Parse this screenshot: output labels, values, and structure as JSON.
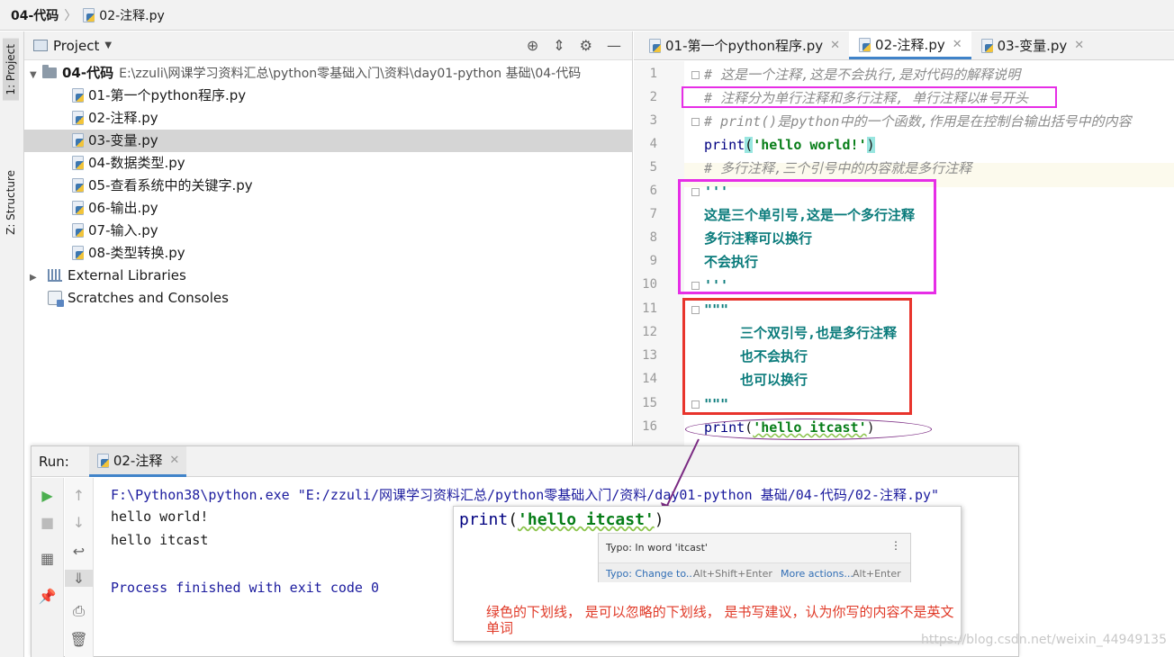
{
  "breadcrumb": {
    "folder": "04-代码",
    "file": "02-注释.py"
  },
  "stripe": {
    "project_tab": "1: Project",
    "structure_tab": "Z: Structure"
  },
  "project": {
    "title": "Project",
    "root": {
      "name": "04-代码",
      "path": "E:\\zzuli\\网课学习资料汇总\\python零基础入门\\资料\\day01-python 基础\\04-代码"
    },
    "files": [
      "01-第一个python程序.py",
      "02-注释.py",
      "03-变量.py",
      "04-数据类型.py",
      "05-查看系统中的关键字.py",
      "06-输出.py",
      "07-输入.py",
      "08-类型转换.py"
    ],
    "selected_index": 2,
    "external_libraries": "External Libraries",
    "scratches": "Scratches and Consoles"
  },
  "editor": {
    "tabs": [
      "01-第一个python程序.py",
      "02-注释.py",
      "03-变量.py"
    ],
    "active_tab": 1,
    "line_numbers": [
      "1",
      "2",
      "3",
      "4",
      "5",
      "6",
      "7",
      "8",
      "9",
      "10",
      "11",
      "12",
      "13",
      "14",
      "15",
      "16"
    ],
    "lines": {
      "l1": "# 这是一个注释,这是不会执行,是对代码的解释说明",
      "l2": "# 注释分为单行注释和多行注释, 单行注释以#号开头",
      "l3": "# print()是python中的一个函数,作用是在控制台输出括号中的内容",
      "l4_fn": "print",
      "l4_open": "(",
      "l4_str": "'hello world!'",
      "l4_close": ")",
      "l5": "# 多行注释,三个引号中的内容就是多行注释",
      "l6": "'''",
      "l7": "这是三个单引号,这是一个多行注释",
      "l8": "多行注释可以换行",
      "l9": "不会执行",
      "l10": "'''",
      "l11": "\"\"\"",
      "l12": "三个双引号,也是多行注释",
      "l13": "也不会执行",
      "l14": "也可以换行",
      "l15": "\"\"\"",
      "l16_fn": "print",
      "l16_open": "(",
      "l16_str": "'hello itcast'",
      "l16_close": ")"
    }
  },
  "run": {
    "label": "Run:",
    "tab": "02-注释",
    "console": [
      "F:\\Python38\\python.exe \"E:/zzuli/网课学习资料汇总/python零基础入门/资料/day01-python 基础/04-代码/02-注释.py\"",
      "hello world!",
      "hello itcast",
      "Process finished with exit code 0"
    ]
  },
  "callout": {
    "code_fn": "print",
    "code_open": "(",
    "code_str": "'hello itcast'",
    "code_close": ")",
    "typo_title": "Typo: In word 'itcast'",
    "typo_change": "Typo: Change to...",
    "typo_change_key": "Alt+Shift+Enter",
    "typo_more": "More actions...",
    "typo_more_key": "Alt+Enter",
    "note": "绿色的下划线， 是可以忽略的下划线， 是书写建议，认为你写的内容不是英文单词"
  },
  "watermark": "https://blog.csdn.net/weixin_44949135",
  "colors": {
    "magenta_box": "#e62ee6",
    "red_box": "#e8342c",
    "purple_ellipse": "#7a2a82",
    "accent": "#4083c9"
  }
}
